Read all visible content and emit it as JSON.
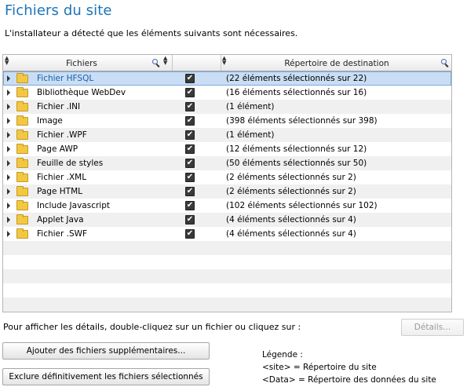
{
  "title": "Fichiers du site",
  "subtitle": "L'installateur a détecté que les éléments suivants sont nécessaires.",
  "table": {
    "columns": {
      "files": "Fichiers",
      "destination": "Répertoire de destination"
    },
    "rows": [
      {
        "name": "Fichier HFSQL",
        "checked": true,
        "destination": "(22 éléments sélectionnés sur 22)",
        "selected": true
      },
      {
        "name": "Bibliothèque WebDev",
        "checked": true,
        "destination": "(16 éléments sélectionnés sur 16)"
      },
      {
        "name": "Fichier .INI",
        "checked": true,
        "destination": "(1 élément)"
      },
      {
        "name": "Image",
        "checked": true,
        "destination": "(398 éléments sélectionnés sur 398)"
      },
      {
        "name": "Fichier .WPF",
        "checked": true,
        "destination": "(1 élément)"
      },
      {
        "name": "Page AWP",
        "checked": true,
        "destination": "(12 éléments sélectionnés sur 12)"
      },
      {
        "name": "Feuille de styles",
        "checked": true,
        "destination": "(50 éléments sélectionnés sur 50)"
      },
      {
        "name": "Fichier .XML",
        "checked": true,
        "destination": "(2 éléments sélectionnés sur 2)"
      },
      {
        "name": "Page HTML",
        "checked": true,
        "destination": "(2 éléments sélectionnés sur 2)"
      },
      {
        "name": "Include Javascript",
        "checked": true,
        "destination": "(102 éléments sélectionnés sur 102)"
      },
      {
        "name": "Applet Java",
        "checked": true,
        "destination": "(4 éléments sélectionnés sur 4)"
      },
      {
        "name": "Fichier .SWF",
        "checked": true,
        "destination": "(4 éléments sélectionnés sur 4)"
      }
    ]
  },
  "hint": "Pour afficher les détails, double-cliquez sur un fichier ou cliquez sur :",
  "buttons": {
    "details": "Détails...",
    "add_files": "Ajouter des fichiers supplémentaires...",
    "exclude_files": "Exclure définitivement les fichiers sélectionnés"
  },
  "legend": {
    "title": "Légende :",
    "site": "<site> = Répertoire du site",
    "data": "<Data> = Répertoire des données du site"
  },
  "colors": {
    "title": "#1c74b8",
    "selected_row": "#c9def4",
    "folder": "#f2c744"
  }
}
